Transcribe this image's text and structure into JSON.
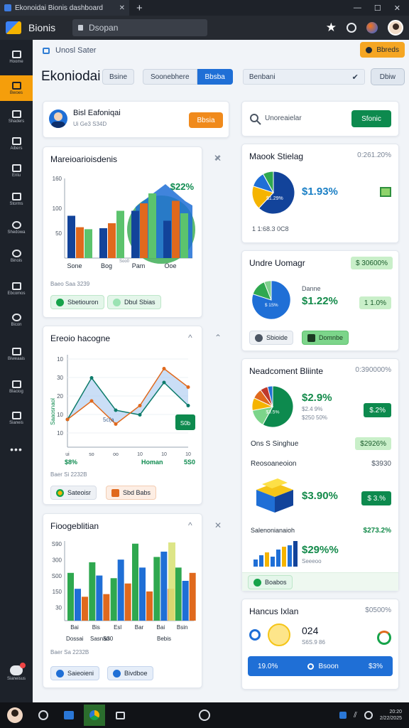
{
  "browser": {
    "tab_title": "Ekonoidai Bionis dashboard",
    "app_name": "Bionis",
    "url_placeholder": "Dsopan"
  },
  "rail": {
    "items": [
      {
        "label": "Hoome",
        "active": false
      },
      {
        "label": "Bwoes",
        "active": true
      },
      {
        "label": "Shaders",
        "active": false
      },
      {
        "label": "Aibers",
        "active": false
      },
      {
        "label": "Enlu",
        "active": false
      },
      {
        "label": "Storms",
        "active": false
      },
      {
        "label": "Shedowa",
        "active": false
      },
      {
        "label": "Binois",
        "active": false
      },
      {
        "label": "Ebcomos",
        "active": false
      },
      {
        "label": "Bicon",
        "active": false
      },
      {
        "label": "Biweaais",
        "active": false
      },
      {
        "label": "Blaciog",
        "active": false
      },
      {
        "label": "Sianeis",
        "active": false
      }
    ],
    "bottom_label": "Sianeisus"
  },
  "header": {
    "crumb": "Unosl Sater",
    "alert_label": "Bbreds",
    "title": "Ekoniodai",
    "chip": "Bsine",
    "seg_left": "Soonebhere",
    "seg_right": "Bbsba",
    "filter_value": "Benbani",
    "action_label": "Dbiw"
  },
  "profile": {
    "name": "Bisl Eafoniqai",
    "meta": "Ui Ge3 S34D",
    "button": "Bbsia"
  },
  "search": {
    "placeholder": "Unoreaielar",
    "button": "Sfonic"
  },
  "bar_card": {
    "title": "Mareioarioisdenis",
    "value": "$22%",
    "ticks": [
      "160",
      "100",
      "50"
    ],
    "xlabels": [
      "Sone",
      "Bog",
      "Pam",
      "Ooe"
    ],
    "xlabel_top": "Soo0",
    "foot": "Baeo Saa 3239",
    "pill_a": "Sbetiouron",
    "pill_b": "Dbul Sbias"
  },
  "line_card": {
    "title": "Ereoio hacogne",
    "ticks": [
      "10",
      "30",
      "20",
      "10",
      "10"
    ],
    "xlabels": [
      "ui",
      "so",
      "oo",
      "10",
      "10",
      "10"
    ],
    "callout": "S0b",
    "val_a": "$8%",
    "val_b": "Homan",
    "val_c": "5S0",
    "ylabel": "Saaosnaol",
    "inner": "5c(a",
    "foot": "Baer Si 2232B",
    "pill_a": "Sateoisr",
    "pill_b": "Sbd Babs"
  },
  "col_card": {
    "title": "Fioogeblitian",
    "ticks": [
      "S90",
      "300",
      "S00",
      "150",
      "30"
    ],
    "xlabels": [
      "Bai",
      "Bis",
      "Esl",
      "Bar",
      "Bai",
      "Bsin"
    ],
    "sub_a": "Dossai",
    "sub_b": "Sasnan",
    "sub_c": "S30",
    "sub_d": "Bebis",
    "foot": "Baer Sa 2232B",
    "pill_a": "Saieoieni",
    "pill_b": "Bivdboe"
  },
  "pie_card_1": {
    "title": "Maook Stielag",
    "pct": "0:261.20%",
    "value": "$1.93%",
    "slice_label": "$1.29%",
    "foot": "1 1:68.3 0C8"
  },
  "pie_card_2": {
    "title": "Undre Uomagr",
    "badge": "$ 30600%",
    "value": "$1.22%",
    "sub": "Danne",
    "chip": "1 1.0%",
    "slice_label": "$ 1S%",
    "pill_a": "Sbioide",
    "pill_b": "Domnbe"
  },
  "pie_card_3": {
    "title": "Neadcoment Bliinte",
    "pct": "0:390000%",
    "value": "$2.9%",
    "sub_a": "$2.4 9%",
    "sub_b": "$250 50%",
    "slice_label": "$3.5%",
    "badge": "$.2%",
    "row1_label": "Ons S Singhue",
    "row1_value": "$2926%",
    "row2_label": "Reosoaneoion",
    "row2_value": "$3930",
    "product_value": "$3.90%",
    "product_badge": "$ 3.%",
    "row3_label": "Salenonianaioh",
    "row3_value": "$273.2%",
    "bars_value": "$29%%",
    "bars_sub": "Seeeoo",
    "pill": "Boabos"
  },
  "stat_card": {
    "title": "Hancus Ixlan",
    "pct": "$0500%",
    "value": "024",
    "sub": "S6S.9 86",
    "action_left": "19.0%",
    "action_mid": "Bsoon",
    "action_right": "$3%"
  },
  "taskbar": {
    "time": "20:20",
    "date": "2/22/2025"
  },
  "chart_data": [
    {
      "type": "bar",
      "title": "Mareioarioisdenis",
      "categories": [
        "Sone",
        "Bog",
        "Pam",
        "Ooe"
      ],
      "ylim": [
        0,
        160
      ],
      "series": [
        {
          "values": [
            85,
            60,
            95,
            75
          ]
        },
        {
          "values": [
            62,
            70,
            110,
            115
          ]
        },
        {
          "values": [
            58,
            95,
            130,
            90
          ]
        }
      ]
    },
    {
      "type": "line",
      "title": "Ereoio hacogne",
      "x": [
        0,
        1,
        2,
        3,
        4,
        5
      ],
      "series": [
        {
          "values": [
            12,
            30,
            16,
            14,
            28,
            18
          ]
        },
        {
          "values": [
            12,
            20,
            10,
            18,
            34,
            26
          ]
        }
      ]
    },
    {
      "type": "bar",
      "title": "Fioogeblitian",
      "categories": [
        "Bai",
        "Bis",
        "Esl",
        "Bar",
        "Bai",
        "Bsin"
      ],
      "ylim": [
        0,
        300
      ],
      "series": [
        {
          "values": [
            180,
            220,
            160,
            290,
            240,
            200
          ]
        },
        {
          "values": [
            120,
            170,
            230,
            200,
            260,
            150
          ]
        },
        {
          "values": [
            90,
            100,
            140,
            110,
            120,
            180
          ]
        }
      ]
    },
    {
      "type": "pie",
      "title": "Maook Stielag",
      "values": [
        62,
        18,
        12,
        8
      ]
    },
    {
      "type": "pie",
      "title": "Undre Uomagr",
      "values": [
        80,
        14,
        6
      ]
    },
    {
      "type": "pie",
      "title": "Neadcoment Bliinte",
      "values": [
        58,
        14,
        10,
        8,
        6,
        4
      ]
    }
  ],
  "colors": {
    "accent": "#f59e0b",
    "primary": "#1f6fd6",
    "green": "#0d8a4e",
    "navy": "#12439a",
    "orange": "#e0691d"
  }
}
